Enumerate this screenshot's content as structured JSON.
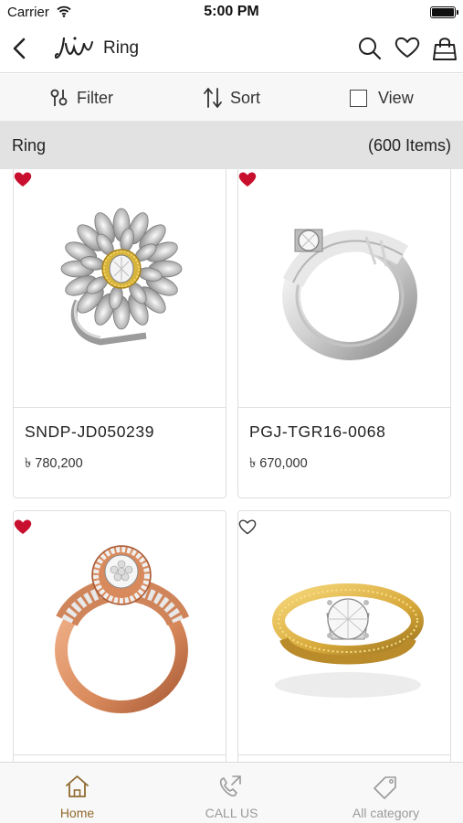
{
  "status_bar": {
    "carrier": "Carrier",
    "time": "5:00 PM"
  },
  "nav": {
    "title": "Ring",
    "logo_text": "JW"
  },
  "toolbar": {
    "filter_label": "Filter",
    "sort_label": "Sort",
    "view_label": "View"
  },
  "category": {
    "name": "Ring",
    "count": "(600 Items)"
  },
  "products": [
    {
      "sku": "SNDP-JD050239",
      "price": "৳ 780,200",
      "favorite": true
    },
    {
      "sku": "PGJ-TGR16-0068",
      "price": "৳ 670,000",
      "favorite": true
    },
    {
      "sku": "",
      "price": "",
      "favorite": true
    },
    {
      "sku": "",
      "price": "",
      "favorite": false
    }
  ],
  "tabs": [
    {
      "label": "Home",
      "icon": "home-icon",
      "active": true
    },
    {
      "label": "CALL US",
      "icon": "phone-icon",
      "active": false
    },
    {
      "label": "All category",
      "icon": "tag-icon",
      "active": false
    }
  ],
  "colors": {
    "favorite": "#c8102e",
    "accent": "#8f6a2e",
    "inactive": "#9a9a9a"
  }
}
